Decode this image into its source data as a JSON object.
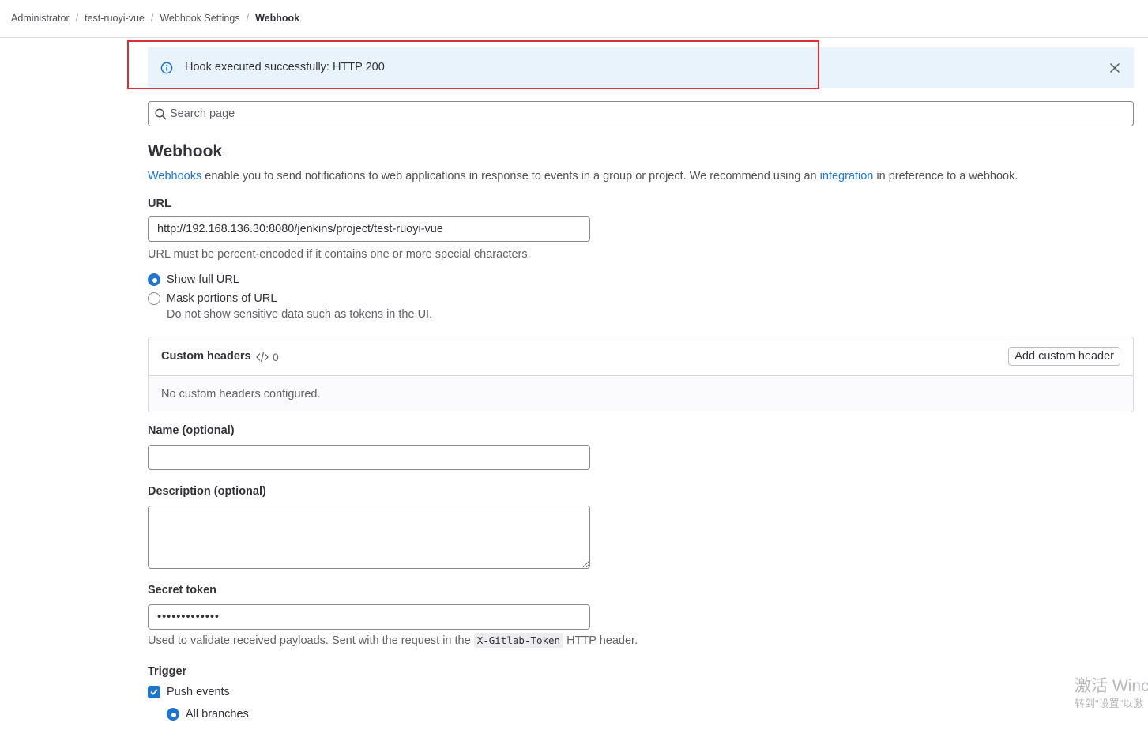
{
  "breadcrumb": {
    "items": [
      "Administrator",
      "test-ruoyi-vue",
      "Webhook Settings",
      "Webhook"
    ],
    "separator": "/"
  },
  "alert": {
    "message": "Hook executed successfully: HTTP 200",
    "icon": "info-icon",
    "close_icon": "close-icon"
  },
  "search": {
    "placeholder": "Search page"
  },
  "page": {
    "title": "Webhook",
    "intro_link1": "Webhooks",
    "intro_mid": " enable you to send notifications to web applications in response to events in a group or project. We recommend using an ",
    "intro_link2": "integration",
    "intro_end": " in preference to a webhook."
  },
  "url": {
    "label": "URL",
    "value": "http://192.168.136.30:8080/jenkins/project/test-ruoyi-vue",
    "help": "URL must be percent-encoded if it contains one or more special characters."
  },
  "url_display": {
    "show_full_label": "Show full URL",
    "mask_label": "Mask portions of URL",
    "mask_help": "Do not show sensitive data such as tokens in the UI.",
    "selected": "Show full URL"
  },
  "custom_headers": {
    "title": "Custom headers",
    "count": "0",
    "add_button": "Add custom header",
    "empty_text": "No custom headers configured."
  },
  "name": {
    "label": "Name (optional)",
    "value": ""
  },
  "description": {
    "label": "Description (optional)",
    "value": ""
  },
  "secret_token": {
    "label": "Secret token",
    "value": "•••••••••••••",
    "help_before": "Used to validate received payloads. Sent with the request in the ",
    "help_code": "X-Gitlab-Token",
    "help_after": " HTTP header."
  },
  "trigger": {
    "label": "Trigger",
    "push_events_label": "Push events",
    "push_events_checked": true,
    "all_branches_label": "All branches",
    "all_branches_selected": true
  },
  "watermark": {
    "line1": "激活 Winc",
    "line2": "转到\"设置\"以激"
  },
  "colors": {
    "accent": "#1f75cb",
    "alert_bg": "#e9f3fc",
    "highlight": "#d9303a"
  }
}
